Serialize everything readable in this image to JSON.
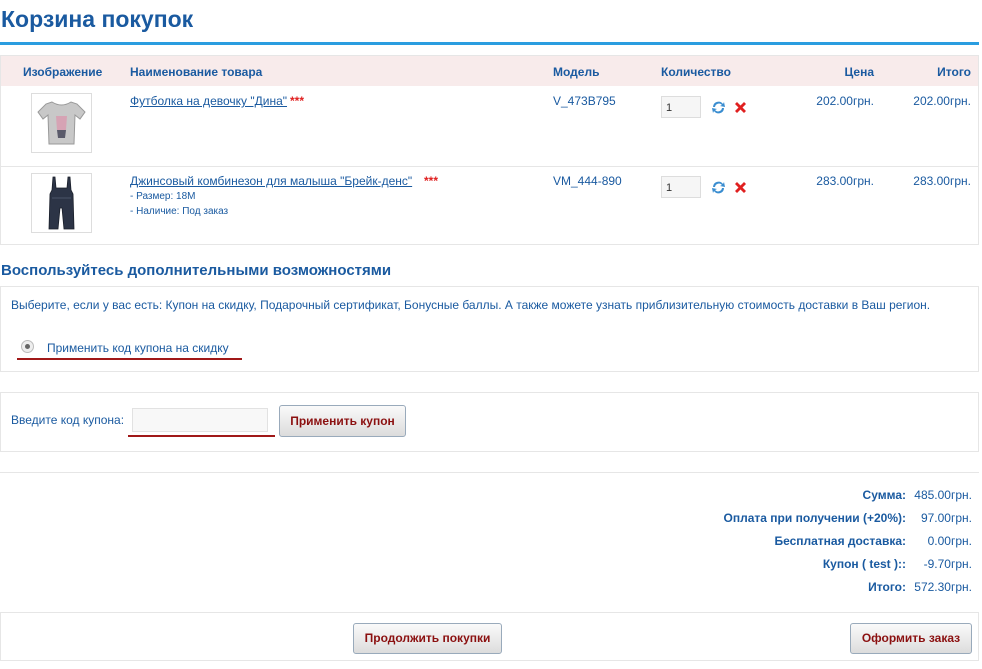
{
  "page_title": "Корзина покупок",
  "cart": {
    "columns": {
      "image": "Изображение",
      "name": "Наименование товара",
      "model": "Модель",
      "quantity": "Количество",
      "price": "Цена",
      "total": "Итого"
    },
    "items": [
      {
        "name": "Футболка на девочку \"Дина\"",
        "stars": "***",
        "options": [],
        "model": "V_473B795",
        "quantity": "1",
        "price": "202.00грн.",
        "total": "202.00грн."
      },
      {
        "name": "Джинсовый комбинезон для малыша \"Брейк-денс\"",
        "stars": "***",
        "options": [
          "- Размер: 18М",
          "- Наличие: Под заказ"
        ],
        "model": "VM_444-890",
        "quantity": "1",
        "price": "283.00грн.",
        "total": "283.00грн."
      }
    ]
  },
  "extras": {
    "title": "Воспользуйтесь дополнительными возможностями",
    "description": "Выберите, если у вас есть: Купон на скидку, Подарочный сертификат, Бонусные баллы. А также можете узнать приблизительную стоимость доставки в Ваш регион.",
    "coupon_option": "Применить код купона на скидку"
  },
  "coupon": {
    "label": "Введите код купона:",
    "value": "",
    "button": "Применить купон"
  },
  "totals": [
    {
      "label": "Сумма:",
      "value": "485.00грн."
    },
    {
      "label": "Оплата при получении (+20%):",
      "value": "97.00грн."
    },
    {
      "label": "Бесплатная доставка:",
      "value": "0.00грн."
    },
    {
      "label": "Купон ( test )::",
      "value": "-9.70грн."
    },
    {
      "label": "Итого:",
      "value": "572.30грн."
    }
  ],
  "buttons": {
    "continue": "Продолжить покупки",
    "checkout": "Оформить заказ"
  },
  "colors": {
    "accent": "#1a5aa0",
    "rule": "#2a9de0",
    "header_bg": "#f8ebeb",
    "highlight": "#a01818",
    "remove": "#e02020"
  },
  "icons": {
    "update": "refresh-icon",
    "remove": "close-icon"
  }
}
